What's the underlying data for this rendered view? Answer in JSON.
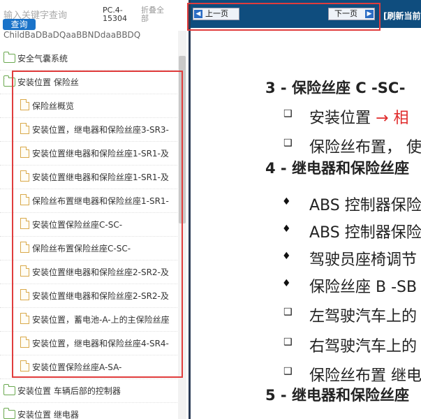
{
  "search": {
    "hint": "输入关键字查询",
    "button": "查询"
  },
  "model": {
    "label": "PC.4-15304"
  },
  "collapse_label": "折叠全部",
  "tree_cut": "ChildBaDBaDQaaBBNDdaaBBDQ",
  "tree": [
    {
      "type": "folder",
      "label": "安全气囊系统"
    },
    {
      "type": "folder",
      "label": "安装位置 保险丝"
    },
    {
      "type": "file",
      "label": "保险丝概览"
    },
    {
      "type": "file",
      "label": "安装位置，继电器和保险丝座3-SR3-"
    },
    {
      "type": "file",
      "label": "安装位置继电器和保险丝座1-SR1-及"
    },
    {
      "type": "file",
      "label": "安装位置继电器和保险丝座1-SR1-及"
    },
    {
      "type": "file",
      "label": "保险丝布置继电器和保险丝座1-SR1-"
    },
    {
      "type": "file",
      "label": "安装位置保险丝座C-SC-"
    },
    {
      "type": "file",
      "label": "保险丝布置保险丝座C-SC-"
    },
    {
      "type": "file",
      "label": "安装位置继电器和保险丝座2-SR2-及"
    },
    {
      "type": "file",
      "label": "安装位置继电器和保险丝座2-SR2-及"
    },
    {
      "type": "file",
      "label": "安装位置，蓄电池-A-上的主保险丝座"
    },
    {
      "type": "file",
      "label": "安装位置，继电器和保险丝座4-SR4-"
    },
    {
      "type": "file",
      "label": "安装位置保险丝座A-SA-"
    },
    {
      "type": "folder",
      "label": "安装位置 车辆后部的控制器"
    },
    {
      "type": "folder",
      "label": "安装位置 继电器"
    }
  ],
  "nav": {
    "prev": "上一页",
    "next": "下一页",
    "refresh": "[刷新当前"
  },
  "content": {
    "h3": "3 - 保险丝座 C -SC-",
    "h3_item1": "安装位置",
    "h3_item1_arrow": "→ 相",
    "h3_item2": "保险丝布置，  使",
    "h4": "4 - 继电器和保险丝座",
    "d1": "ABS 控制器保险",
    "d2": "ABS 控制器保险",
    "d3": "驾驶员座椅调节",
    "d4": "保险丝座 B -SB",
    "s1": "左驾驶汽车上的",
    "s2": "右驾驶汽车上的",
    "s3": "保险丝布置 继电",
    "h5": "5 - 继电器和保险丝座"
  }
}
